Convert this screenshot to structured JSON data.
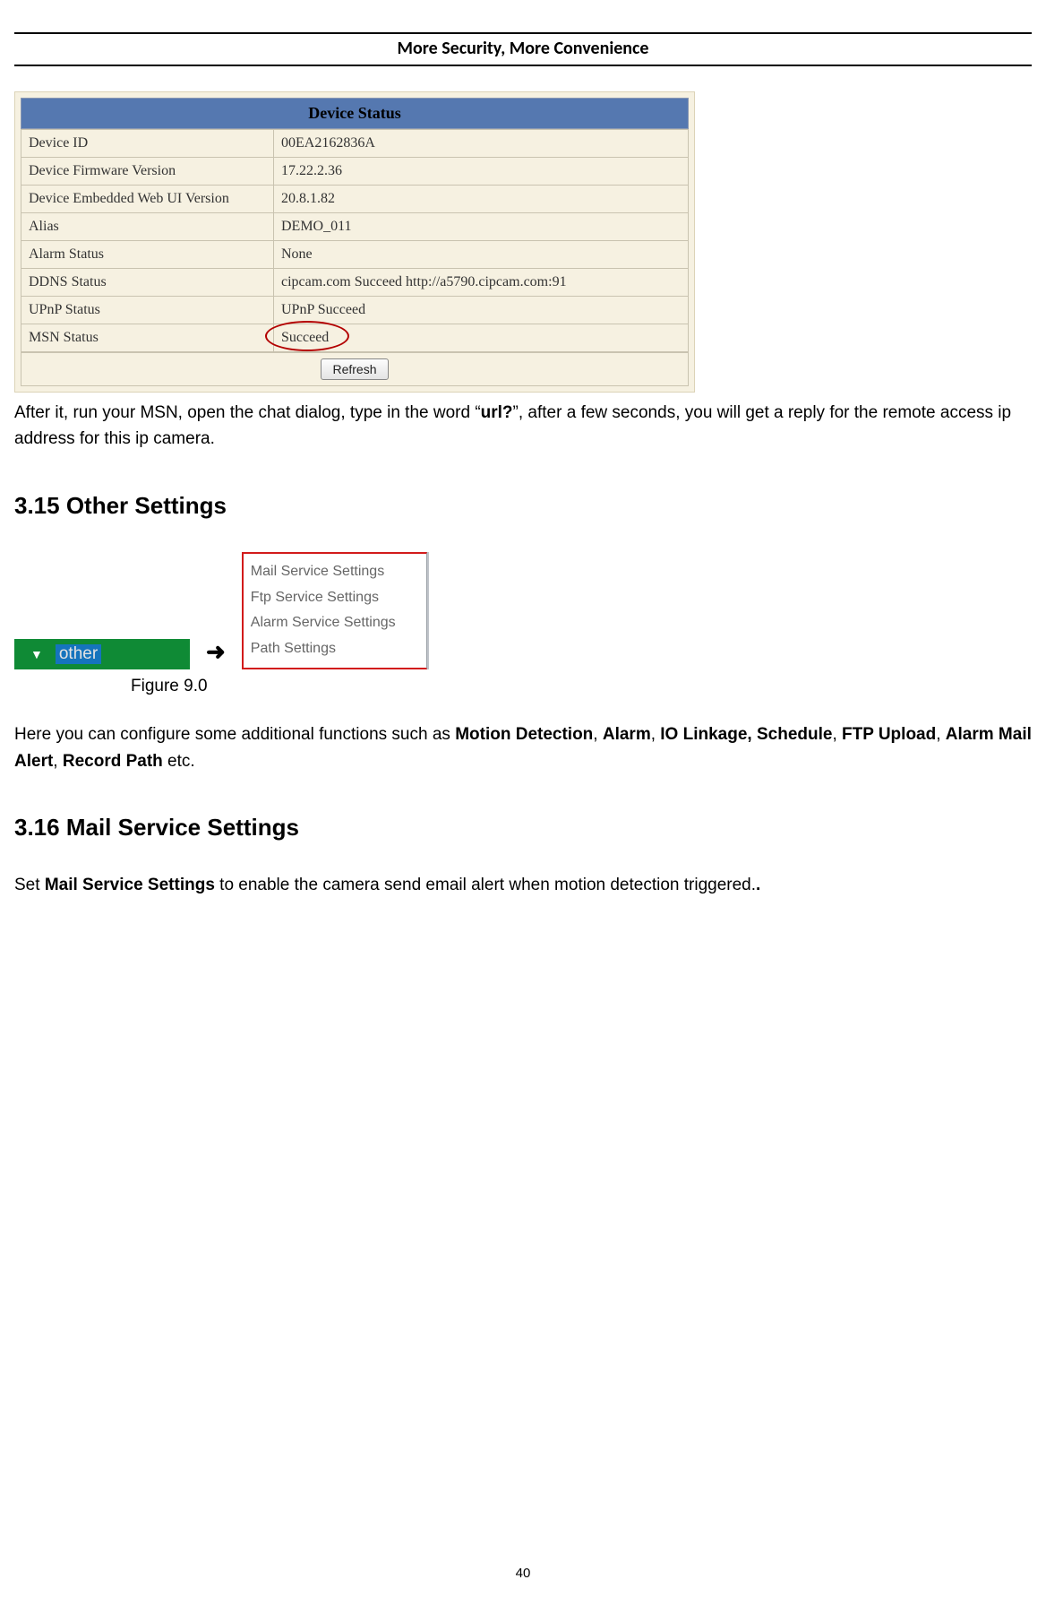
{
  "header": {
    "tagline": "More Security, More Convenience"
  },
  "status": {
    "title": "Device Status",
    "rows": [
      {
        "k": "Device ID",
        "v": "00EA2162836A"
      },
      {
        "k": "Device Firmware Version",
        "v": "17.22.2.36"
      },
      {
        "k": "Device Embedded Web UI Version",
        "v": "20.8.1.82"
      },
      {
        "k": "Alias",
        "v": "DEMO_011"
      },
      {
        "k": "Alarm Status",
        "v": "None"
      },
      {
        "k": "DDNS Status",
        "v": "cipcam.com  Succeed  http://a5790.cipcam.com:91"
      },
      {
        "k": "UPnP Status",
        "v": "UPnP Succeed"
      },
      {
        "k": "MSN Status",
        "v": "Succeed"
      }
    ],
    "refresh": "Refresh"
  },
  "para1": {
    "pre": "After it, run your MSN, open the chat dialog, type in the word “",
    "bold": "url?",
    "post": "”, after a few seconds, you will get a reply for the remote access ip address for this ip camera."
  },
  "sec315": "3.15 Other Settings",
  "fig90": {
    "other_label": "other",
    "arrow": "➜",
    "menu": [
      "Mail Service Settings",
      "Ftp Service Settings",
      "Alarm Service Settings",
      "Path Settings"
    ],
    "caption": "Figure 9.0"
  },
  "para2": {
    "pre": "Here you can configure some additional functions such as ",
    "b1": "Motion Detection",
    "s1": ", ",
    "b2": "Alarm",
    "s2": ", ",
    "b3": "IO Linkage, Schedule",
    "s3": ", ",
    "b4": "FTP Upload",
    "s4": ", ",
    "b5": "Alarm Mail Alert",
    "s5": ", ",
    "b6": "Record Path",
    "post": " etc."
  },
  "sec316": "3.16 Mail Service Settings",
  "para3": {
    "pre": "Set ",
    "bold": "Mail Service Settings",
    "post": " to enable the camera send email alert when motion detection triggered."
  },
  "page_number": "40"
}
